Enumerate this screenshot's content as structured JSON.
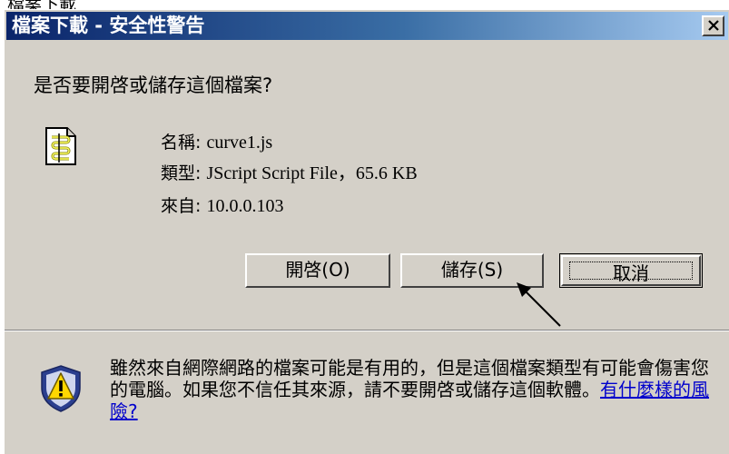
{
  "background_window": {
    "text": "檔案下載"
  },
  "dialog": {
    "title": "檔案下載 - 安全性警告",
    "question": "是否要開啓或儲存這個檔案?",
    "file": {
      "name_label": "名稱:",
      "name_value": "curve1.js",
      "type_label": "類型:",
      "type_value": "JScript Script File，65.6 KB",
      "from_label": "來自:",
      "from_value": "10.0.0.103"
    },
    "buttons": {
      "open": "開啓(O)",
      "save": "儲存(S)",
      "cancel": "取消"
    },
    "warning": {
      "text": "雖然來自網際網路的檔案可能是有用的，但是這個檔案類型有可能會傷害您的電腦。如果您不信任其來源，請不要開啓或儲存這個軟體。",
      "link": "有什麼樣的風險?"
    }
  },
  "icons": {
    "close": "close-icon",
    "file": "script-file-icon",
    "warning": "warning-shield-icon",
    "pointer": "arrow-annotation-icon"
  },
  "colors": {
    "title_gradient_start": "#0a246a",
    "title_gradient_end": "#a6caf0",
    "dialog_face": "#d4d0c8",
    "link": "#0000cc",
    "shield": "#2b3f8f",
    "shield_warning": "#ffd700"
  }
}
